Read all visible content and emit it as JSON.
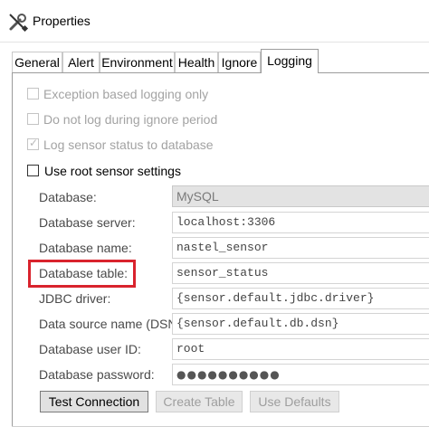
{
  "window": {
    "title": "Properties",
    "icon": "wrench-screwdriver-icon"
  },
  "tabs": [
    {
      "label": "General",
      "active": false
    },
    {
      "label": "Alert",
      "active": false
    },
    {
      "label": "Environment",
      "active": false
    },
    {
      "label": "Health",
      "active": false
    },
    {
      "label": "Ignore",
      "active": false
    },
    {
      "label": "Logging",
      "active": true
    }
  ],
  "logging": {
    "exception_based": {
      "label": "Exception based logging only",
      "checked": false,
      "enabled": false
    },
    "do_not_log_ignore": {
      "label": "Do not log during ignore period",
      "checked": false,
      "enabled": false
    },
    "log_sensor_status": {
      "label": "Log sensor status to database",
      "checked": true,
      "enabled": false
    },
    "use_root_settings": {
      "label": "Use root sensor settings",
      "checked": false,
      "enabled": true
    }
  },
  "fields": {
    "database": {
      "label": "Database:",
      "value": "MySQL"
    },
    "database_server": {
      "label": "Database server:",
      "value": "localhost:3306"
    },
    "database_name": {
      "label": "Database name:",
      "value": "nastel_sensor"
    },
    "database_table": {
      "label": "Database table:",
      "value": "sensor_status"
    },
    "jdbc_driver": {
      "label": "JDBC driver:",
      "value": "{sensor.default.jdbc.driver}"
    },
    "dsn": {
      "label": "Data source name (DSN):",
      "value": "{sensor.default.db.dsn}"
    },
    "user_id": {
      "label": "Database user ID:",
      "value": "root"
    },
    "password": {
      "label": "Database password:",
      "value": "●●●●●●●●●●"
    }
  },
  "buttons": {
    "test_connection": "Test Connection",
    "create_table": "Create Table",
    "use_defaults": "Use Defaults"
  },
  "colors": {
    "highlight": "#d9232d",
    "tab_border": "#9c9c9c",
    "disabled_text": "#a3a3a3"
  }
}
